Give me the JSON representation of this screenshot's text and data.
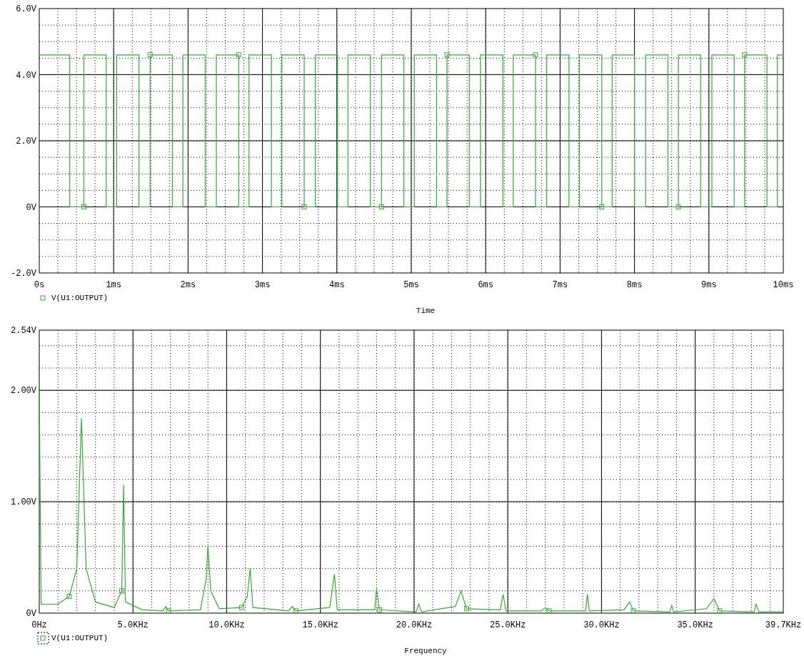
{
  "charts": [
    {
      "legend_selected": false,
      "chart_data": {
        "type": "line",
        "grid": true,
        "xlabel": "Time",
        "xlim": [
          0,
          10
        ],
        "ylim": [
          -2,
          6
        ],
        "xticks": [
          {
            "value": 0,
            "label": "0s"
          },
          {
            "value": 1,
            "label": "1ms"
          },
          {
            "value": 2,
            "label": "2ms"
          },
          {
            "value": 3,
            "label": "3ms"
          },
          {
            "value": 4,
            "label": "4ms"
          },
          {
            "value": 5,
            "label": "5ms"
          },
          {
            "value": 6,
            "label": "6ms"
          },
          {
            "value": 7,
            "label": "7ms"
          },
          {
            "value": 8,
            "label": "8ms"
          },
          {
            "value": 9,
            "label": "9ms"
          },
          {
            "value": 10,
            "label": "10ms"
          }
        ],
        "yticks": [
          {
            "value": -2,
            "label": "-2.0V"
          },
          {
            "value": 0,
            "label": "0V"
          },
          {
            "value": 2,
            "label": "2.0V"
          },
          {
            "value": 4,
            "label": "4.0V"
          },
          {
            "value": 6,
            "label": "6.0V"
          }
        ],
        "x": [
          0,
          0.41,
          0.41,
          0.6,
          0.6,
          0.9,
          0.9,
          1.04,
          1.04,
          1.34,
          1.34,
          1.49,
          1.49,
          1.79,
          1.79,
          1.93,
          1.93,
          2.23,
          2.23,
          2.38,
          2.38,
          2.68,
          2.68,
          2.82,
          2.82,
          3.12,
          3.12,
          3.26,
          3.26,
          3.56,
          3.56,
          3.71,
          3.71,
          4.01,
          4.01,
          4.15,
          4.15,
          4.45,
          4.45,
          4.6,
          4.6,
          4.9,
          4.9,
          5.04,
          5.04,
          5.34,
          5.34,
          5.48,
          5.48,
          5.78,
          5.78,
          5.93,
          5.93,
          6.23,
          6.23,
          6.37,
          6.37,
          6.67,
          6.67,
          6.82,
          6.82,
          7.12,
          7.12,
          7.26,
          7.26,
          7.56,
          7.56,
          7.7,
          7.7,
          8.0,
          8.0,
          8.15,
          8.15,
          8.45,
          8.45,
          8.59,
          8.59,
          8.89,
          8.89,
          9.04,
          9.04,
          9.34,
          9.34,
          9.48,
          9.48,
          9.78,
          9.78,
          9.92,
          9.92,
          10
        ],
        "series": [
          {
            "name": "V(U1:OUTPUT)",
            "color": "#33aa33",
            "values": [
              4.6,
              4.6,
              0,
              0,
              4.6,
              4.6,
              0,
              0,
              4.6,
              4.6,
              0,
              0,
              4.6,
              4.6,
              0,
              0,
              4.6,
              4.6,
              0,
              0,
              4.6,
              4.6,
              0,
              0,
              4.6,
              4.6,
              0,
              0,
              4.6,
              4.6,
              0,
              0,
              4.6,
              4.6,
              0,
              0,
              4.6,
              4.6,
              0,
              0,
              4.6,
              4.6,
              0,
              0,
              4.6,
              4.6,
              0,
              0,
              4.6,
              4.6,
              0,
              0,
              4.6,
              4.6,
              0,
              0,
              4.6,
              4.6,
              0,
              0,
              4.6,
              4.6,
              0,
              0,
              4.6,
              4.6,
              0,
              0,
              4.6,
              4.6,
              0,
              0,
              4.6,
              4.6,
              0,
              0,
              4.6,
              4.6,
              0,
              0,
              4.6,
              4.6,
              0,
              0,
              4.6,
              4.6,
              0,
              0,
              4.6,
              4.6
            ]
          }
        ]
      }
    },
    {
      "legend_selected": true,
      "chart_data": {
        "type": "line",
        "grid": true,
        "xlabel": "Frequency",
        "xlim": [
          0,
          39.7
        ],
        "ylim": [
          0,
          2.54
        ],
        "xticks": [
          {
            "value": 0,
            "label": "0Hz"
          },
          {
            "value": 5,
            "label": "5.0KHz"
          },
          {
            "value": 10,
            "label": "10.0KHz"
          },
          {
            "value": 15,
            "label": "15.0KHz"
          },
          {
            "value": 20,
            "label": "20.0KHz"
          },
          {
            "value": 25,
            "label": "25.0KHz"
          },
          {
            "value": 30,
            "label": "30.0KHz"
          },
          {
            "value": 35,
            "label": "35.0KHz"
          },
          {
            "value": 39.7,
            "label": "39.7KHz"
          }
        ],
        "yticks": [
          {
            "value": 0,
            "label": "0V"
          },
          {
            "value": 1,
            "label": "1.00V"
          },
          {
            "value": 2,
            "label": "2.00V"
          },
          {
            "value": 2.54,
            "label": "2.54V"
          }
        ],
        "x": [
          0,
          0.1,
          1.0,
          1.6,
          2.0,
          2.25,
          2.5,
          3.0,
          4.0,
          4.4,
          4.5,
          4.6,
          5.5,
          6.6,
          6.75,
          6.9,
          8.6,
          8.9,
          9.0,
          9.15,
          9.6,
          10.8,
          11.1,
          11.25,
          11.4,
          13.3,
          13.5,
          13.7,
          15.5,
          15.75,
          15.9,
          17.9,
          18.0,
          18.15,
          20.1,
          20.25,
          20.4,
          22.2,
          22.5,
          22.8,
          24.6,
          24.75,
          24.9,
          26.8,
          27.0,
          27.2,
          29.15,
          29.25,
          29.35,
          31.2,
          31.5,
          31.7,
          33.65,
          33.75,
          33.85,
          35.6,
          36.0,
          36.3,
          38.15,
          38.25,
          38.4,
          39.7
        ],
        "series": [
          {
            "name": "V(U1:OUTPUT)",
            "color": "#33aa33",
            "values": [
              2.0,
              0.08,
              0.08,
              0.15,
              0.4,
              1.75,
              0.4,
              0.1,
              0.05,
              0.2,
              1.15,
              0.1,
              0.03,
              0.02,
              0.06,
              0.02,
              0.03,
              0.3,
              0.6,
              0.2,
              0.04,
              0.05,
              0.15,
              0.4,
              0.05,
              0.02,
              0.06,
              0.02,
              0.05,
              0.35,
              0.03,
              0.03,
              0.22,
              0.03,
              0.01,
              0.08,
              0.01,
              0.06,
              0.2,
              0.04,
              0.03,
              0.17,
              0.02,
              0.02,
              0.05,
              0.02,
              0.02,
              0.17,
              0.02,
              0.03,
              0.1,
              0.02,
              0.01,
              0.07,
              0.01,
              0.04,
              0.13,
              0.02,
              0.01,
              0.08,
              0.01,
              0.01
            ]
          }
        ]
      }
    }
  ]
}
